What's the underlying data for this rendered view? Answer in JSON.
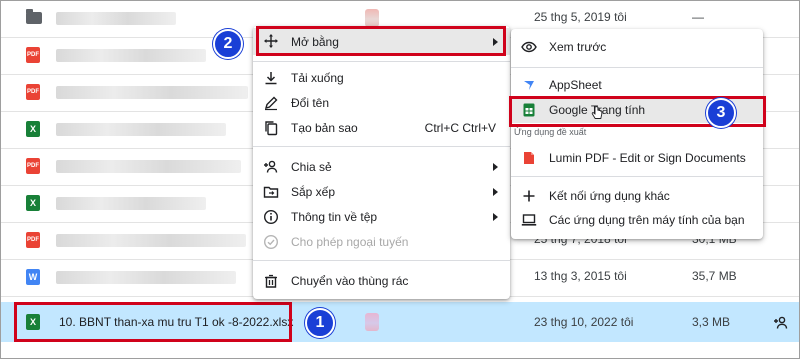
{
  "file_rows": [
    {
      "icon": "folder",
      "date": "25 thg 5, 2019 tôi",
      "size": "—"
    },
    {
      "icon": "pdf",
      "date": "",
      "size": ""
    },
    {
      "icon": "pdf",
      "date": "",
      "size": ""
    },
    {
      "icon": "xls",
      "date": "",
      "size": ""
    },
    {
      "icon": "pdf",
      "date": "",
      "size": ""
    },
    {
      "icon": "xls",
      "date": "",
      "size": ""
    },
    {
      "icon": "pdf",
      "date": "25 thg 7, 2018 tôi",
      "size": "30,1 MB"
    },
    {
      "icon": "doc",
      "date": "13 thg 3, 2015 tôi",
      "size": "35,7 MB"
    }
  ],
  "icon_letters": {
    "pdf": "PDF",
    "xls": "X",
    "doc": "W"
  },
  "selected_file": {
    "name": "10. BBNT than-xa mu tru T1 ok -8-2022.xlsx",
    "icon_letter": "X",
    "date": "23 thg 10, 2022 tôi",
    "size": "3,3 MB"
  },
  "context_menu": {
    "open_with": "Mở bằng",
    "download": "Tải xuống",
    "rename": "Đổi tên",
    "make_copy": "Tạo bản sao",
    "make_copy_shortcut": "Ctrl+C Ctrl+V",
    "share": "Chia sẻ",
    "organize": "Sắp xếp",
    "file_info": "Thông tin về tệp",
    "offline": "Cho phép ngoại tuyến",
    "trash": "Chuyển vào thùng rác"
  },
  "submenu": {
    "preview": "Xem trước",
    "appsheet": "AppSheet",
    "google_sheets": "Google Trang tính",
    "suggested_label": "Ứng dụng đề xuất",
    "lumin": "Lumin PDF - Edit or Sign Documents",
    "connect_more": "Kết nối ứng dụng khác",
    "desktop_apps": "Các ứng dụng trên máy tính của bạn"
  },
  "badges": {
    "b1": "1",
    "b2": "2",
    "b3": "3"
  },
  "colors": {
    "selected_row": "#c2e7ff",
    "highlight_box": "#d0021b",
    "badge": "#1a3fd6",
    "sheets_green": "#188038"
  }
}
